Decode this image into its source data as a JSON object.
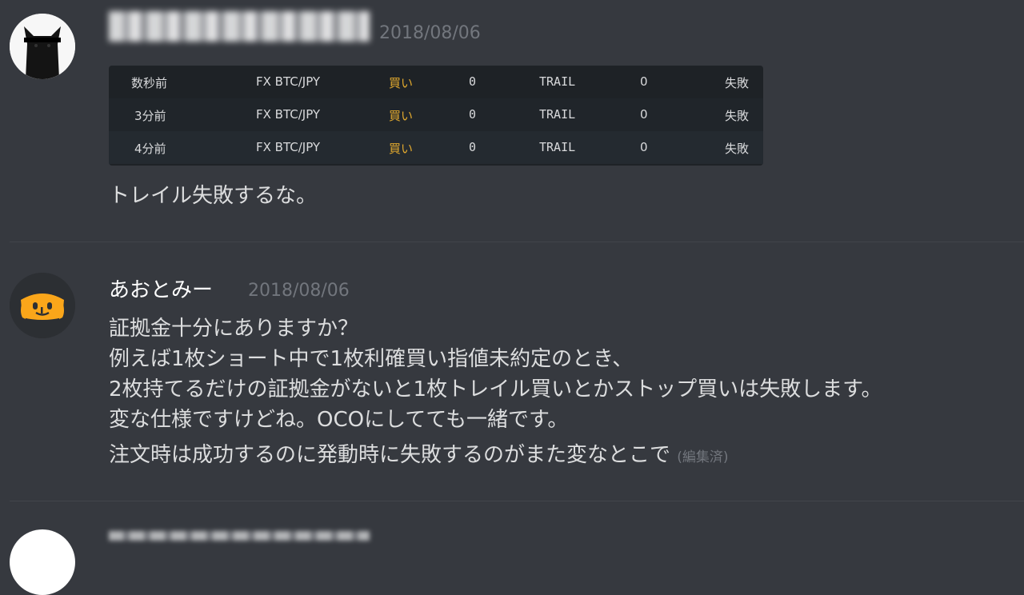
{
  "message1": {
    "timestamp": "2018/08/06",
    "table_rows": [
      [
        "数秒前",
        "FX BTC/JPY",
        "買い",
        "0",
        "TRAIL",
        "0",
        "失敗"
      ],
      [
        "3分前",
        "FX BTC/JPY",
        "買い",
        "0",
        "TRAIL",
        "0",
        "失敗"
      ],
      [
        "4分前",
        "FX BTC/JPY",
        "買い",
        "0",
        "TRAIL",
        "0",
        "失敗"
      ]
    ],
    "text": "トレイル失敗するな。"
  },
  "message2": {
    "username": "あおとみー",
    "timestamp": "2018/08/06",
    "lines": [
      "証拠金十分にありますか？",
      "例えば1枚ショート中で1枚利確買い指値未約定のとき、",
      "2枚持てるだけの証拠金がないと1枚トレイル買いとかストップ買いは失敗します。",
      "変な仕様ですけどね。OCOにしてても一緒です。"
    ],
    "followup": "注文時は成功するのに発動時に失敗するのがまた変なとこで",
    "edited": "(編集済)"
  },
  "colors": {
    "background": "#36393f",
    "embed_bg": "#1e2226",
    "buy_color": "#e0a82e",
    "discord_yellow": "#faa61a",
    "timestamp": "#72767d"
  },
  "icons": [
    "black-cat-avatar-icon",
    "discord-logo-avatar-icon"
  ]
}
